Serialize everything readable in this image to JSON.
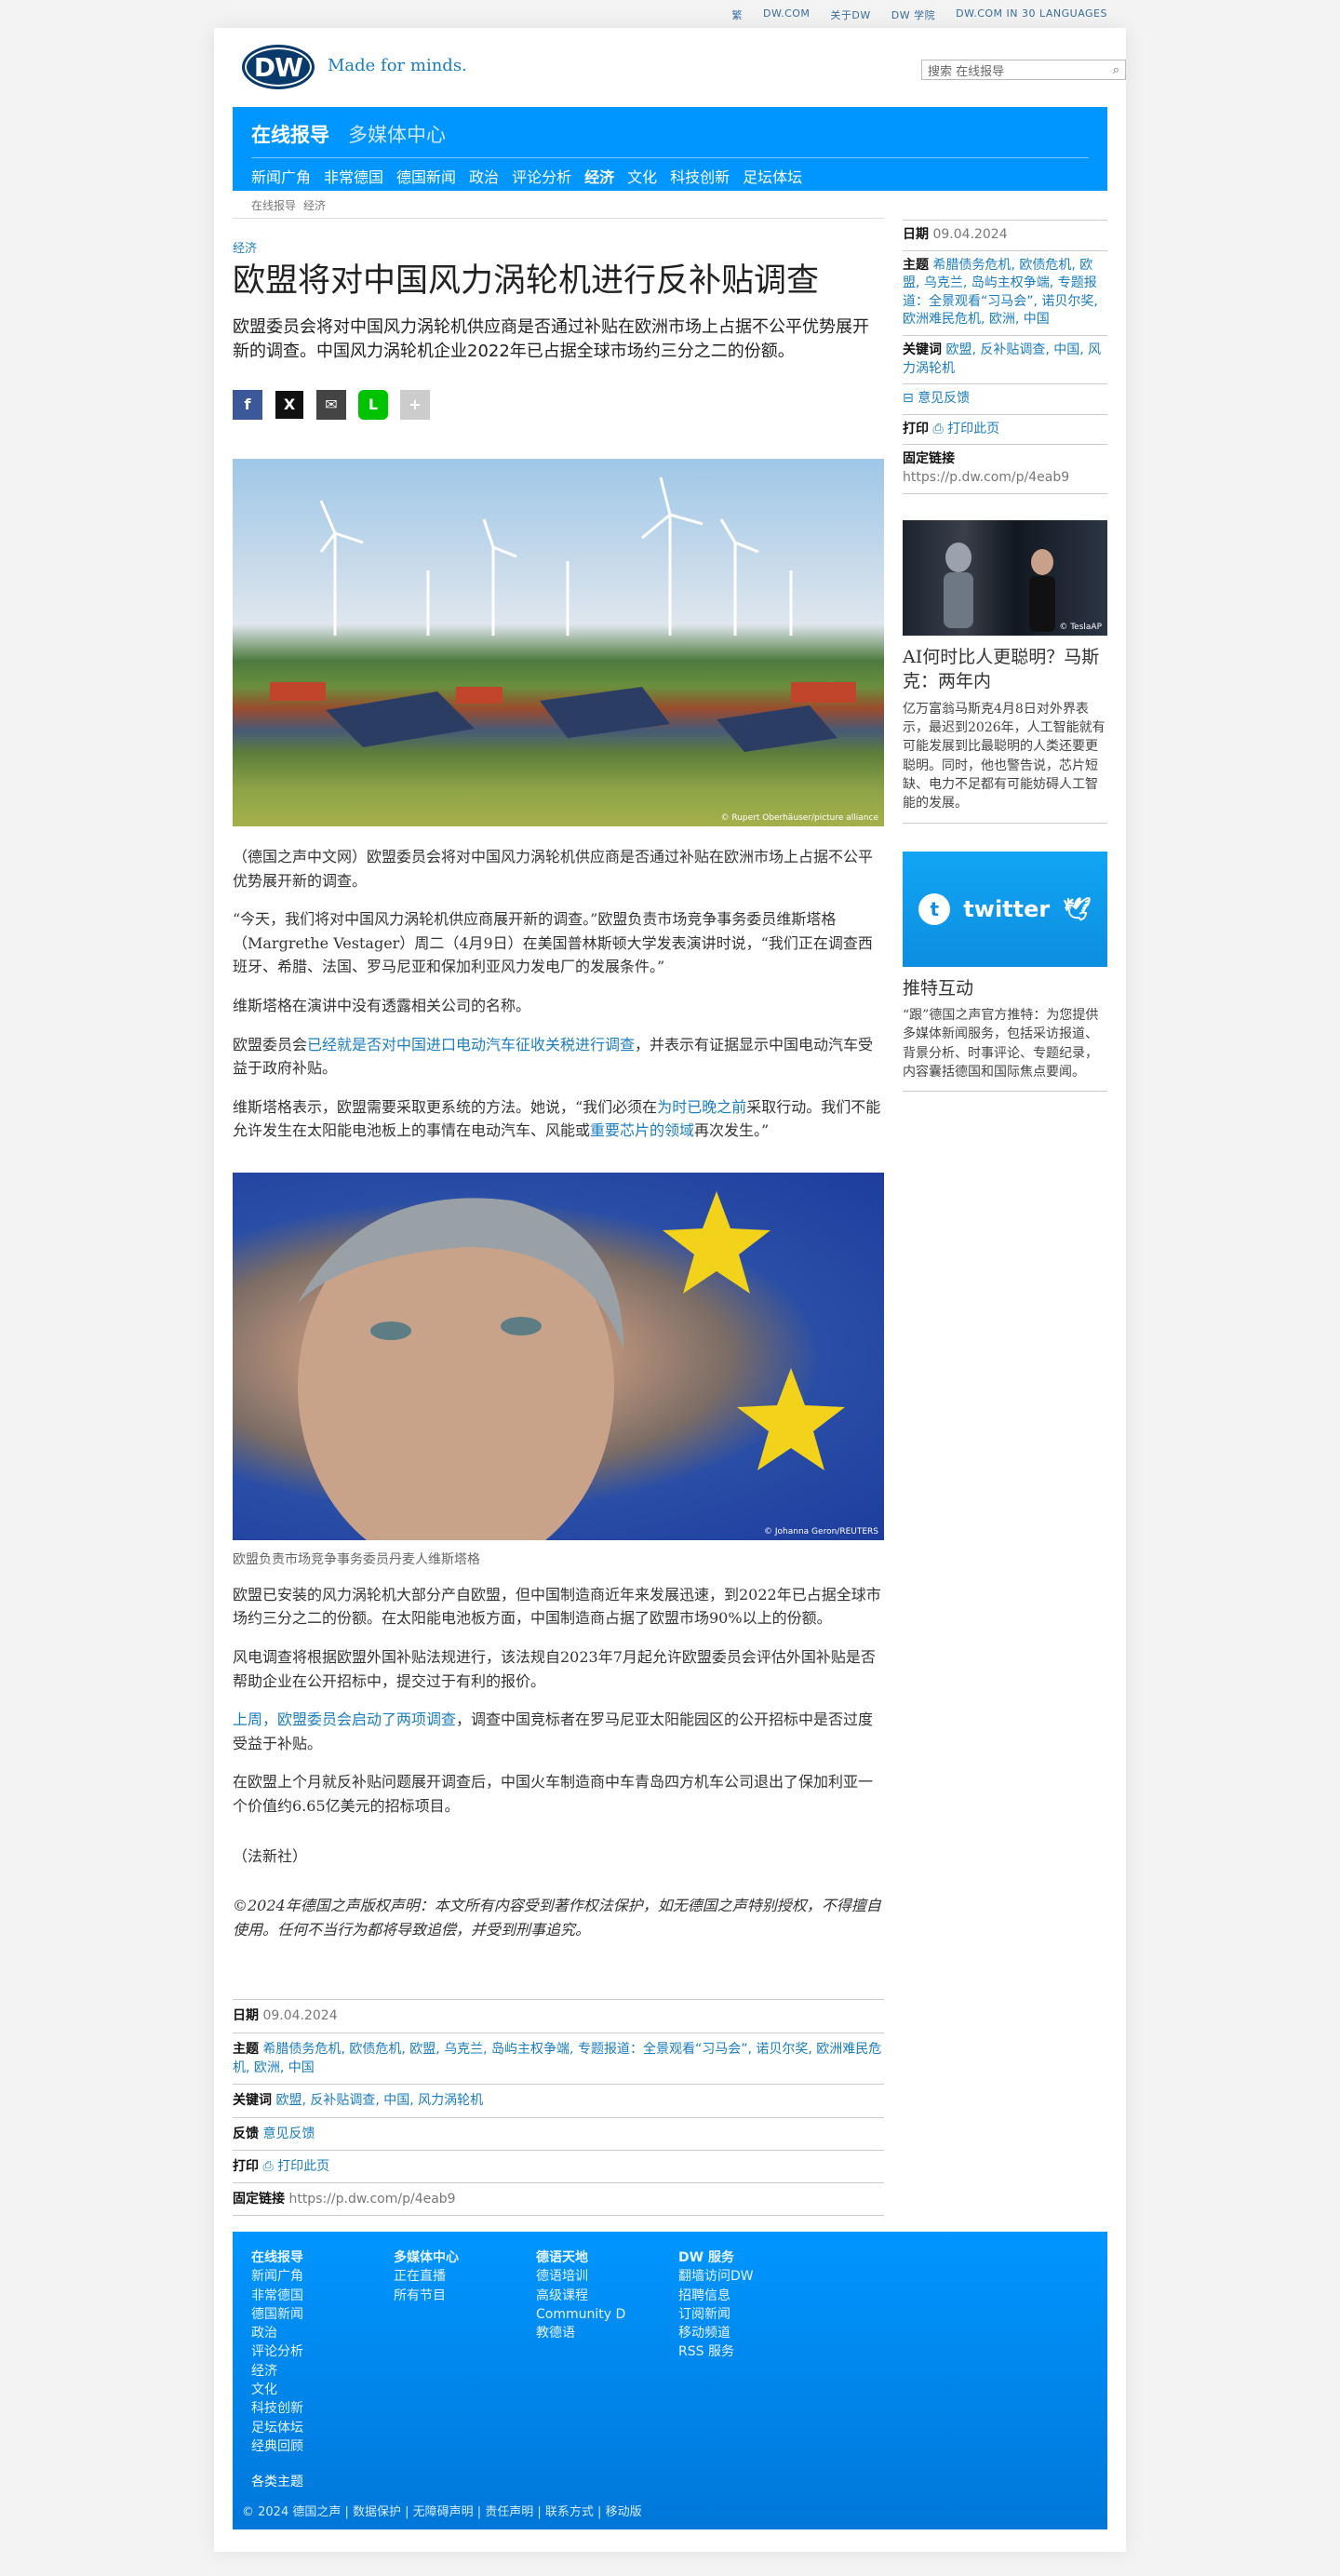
{
  "toplinks": [
    "繁",
    "DW.COM",
    "关于DW",
    "DW 学院",
    "DW.COM IN 30 LANGUAGES"
  ],
  "header": {
    "logo": "DW",
    "tagline": "Made for minds.",
    "search_placeholder": "搜索 在线报导"
  },
  "nav": {
    "main": [
      "在线报导",
      "多媒体中心"
    ],
    "sub": [
      "新闻广角",
      "非常德国",
      "德国新闻",
      "政治",
      "评论分析",
      "经济",
      "文化",
      "科技创新",
      "足坛体坛"
    ]
  },
  "breadcrumb": [
    "在线报导",
    "经济"
  ],
  "article": {
    "kicker": "经济",
    "title": "欧盟将对中国风力涡轮机进行反补贴调查",
    "lead": "欧盟委员会将对中国风力涡轮机供应商是否通过补贴在欧洲市场上占据不公平优势展开新的调查。中国风力涡轮机企业2022年已占据全球市场约三分之二的份额。",
    "share": {
      "fb": "f",
      "x": "X",
      "mail": "✉",
      "line": "L",
      "more": "+"
    },
    "image1_credit": "© Rupert Oberhäuser/picture alliance",
    "p1": "（德国之声中文网）欧盟委员会将对中国风力涡轮机供应商是否通过补贴在欧洲市场上占据不公平优势展开新的调查。",
    "p2": "“今天，我们将对中国风力涡轮机供应商展开新的调查。”欧盟负责市场竞争事务委员维斯塔格（Margrethe Vestager）周二（4月9日）在美国普林斯顿大学发表演讲时说，“我们正在调查西班牙、希腊、法国、罗马尼亚和保加利亚风力发电厂的发展条件。”",
    "p3": "维斯塔格在演讲中没有透露相关公司的名称。",
    "p4_a": "欧盟委员会",
    "p4_link": "已经就是否对中国进口电动汽车征收关税进行调查",
    "p4_b": "，并表示有证据显示中国电动汽车受益于政府补贴。",
    "p5_a": "维斯塔格表示，欧盟需要采取更系统的方法。她说，“我们必须在",
    "p5_link1": "为时已晚之前",
    "p5_b": "采取行动。我们不能允许发生在太阳能电池板上的事情在电动汽车、风能或",
    "p5_link2": "重要芯片的领域",
    "p5_c": "再次发生。”",
    "image2_credit": "© Johanna Geron/REUTERS",
    "image2_caption": "欧盟负责市场竞争事务委员丹麦人维斯塔格",
    "p6": "欧盟已安装的风力涡轮机大部分产自欧盟，但中国制造商近年来发展迅速，到2022年已占据全球市场约三分之二的份额。在太阳能电池板方面，中国制造商占据了欧盟市场90%以上的份额。",
    "p7": "风电调查将根据欧盟外国补贴法规进行，该法规自2023年7月起允许欧盟委员会评估外国补贴是否帮助企业在公开招标中，提交过于有利的报价。",
    "p8_link": "上周，欧盟委员会启动了两项调查",
    "p8_b": "，调查中国竞标者在罗马尼亚太阳能园区的公开招标中是否过度受益于补贴。",
    "p9": "在欧盟上个月就反补贴问题展开调查后，中国火车制造商中车青岛四方机车公司退出了保加利亚一个价值约6.65亿美元的招标项目。",
    "p10": "（法新社）",
    "copyright": "©2024年德国之声版权声明：本文所有内容受到著作权法保护，如无德国之声特别授权，不得擅自使用。任何不当行为都将导致追偿，并受到刑事追究。"
  },
  "meta": {
    "date_label": "日期",
    "date": "09.04.2024",
    "topics_label": "主题",
    "topics": "希腊债务危机, 欧债危机, 欧盟, 乌克兰, 岛屿主权争端, 专题报道：全景观看“习马会”, 诺贝尔奖, 欧洲难民危机, 欧洲, 中国",
    "keywords_label": "关键词",
    "keywords": "欧盟, 反补贴调查, 中国, 风力涡轮机",
    "feedback_label": "反馈",
    "feedback": "意见反馈",
    "print_label": "打印",
    "print": "打印此页",
    "permalink_label": "固定链接",
    "permalink": "https://p.dw.com/p/4eab9"
  },
  "side": {
    "feedback": "意见反馈",
    "teaser_credit": "© TeslaAP",
    "teaser_title": "AI何时比人更聪明？马斯克：两年内",
    "teaser_text": "亿万富翁马斯克4月8日对外界表示，最迟到2026年，人工智能就有可能发展到比最聪明的人类还要更聪明。同时，他也警告说，芯片短缺、电力不足都有可能妨碍人工智能的发展。",
    "twitter_word": "twitter",
    "twitter_title": "推特互动",
    "twitter_text": "“跟”德国之声官方推特：为您提供多媒体新闻服务，包括采访报道、背景分析、时事评论、专题纪录，内容囊括德国和国际焦点要闻。"
  },
  "footer": {
    "col1": {
      "head": "在线报导",
      "items": [
        "新闻广角",
        "非常德国",
        "德国新闻",
        "政治",
        "评论分析",
        "经济",
        "文化",
        "科技创新",
        "足坛体坛",
        "经典回顾"
      ]
    },
    "col2": {
      "head": "多媒体中心",
      "items": [
        "正在直播",
        "所有节目"
      ]
    },
    "col3": {
      "head": "德语天地",
      "items": [
        "德语培训",
        "高级课程",
        "Community D",
        "教德语"
      ]
    },
    "col4": {
      "head": "DW 服务",
      "items": [
        "翻墙访问DW",
        "招聘信息",
        "订阅新闻",
        "移动频道",
        "RSS 服务"
      ]
    },
    "topics": "各类主题",
    "bottom": "© 2024 德国之声 | 数据保护 | 无障碍声明 | 责任声明 | 联系方式 | 移动版"
  }
}
